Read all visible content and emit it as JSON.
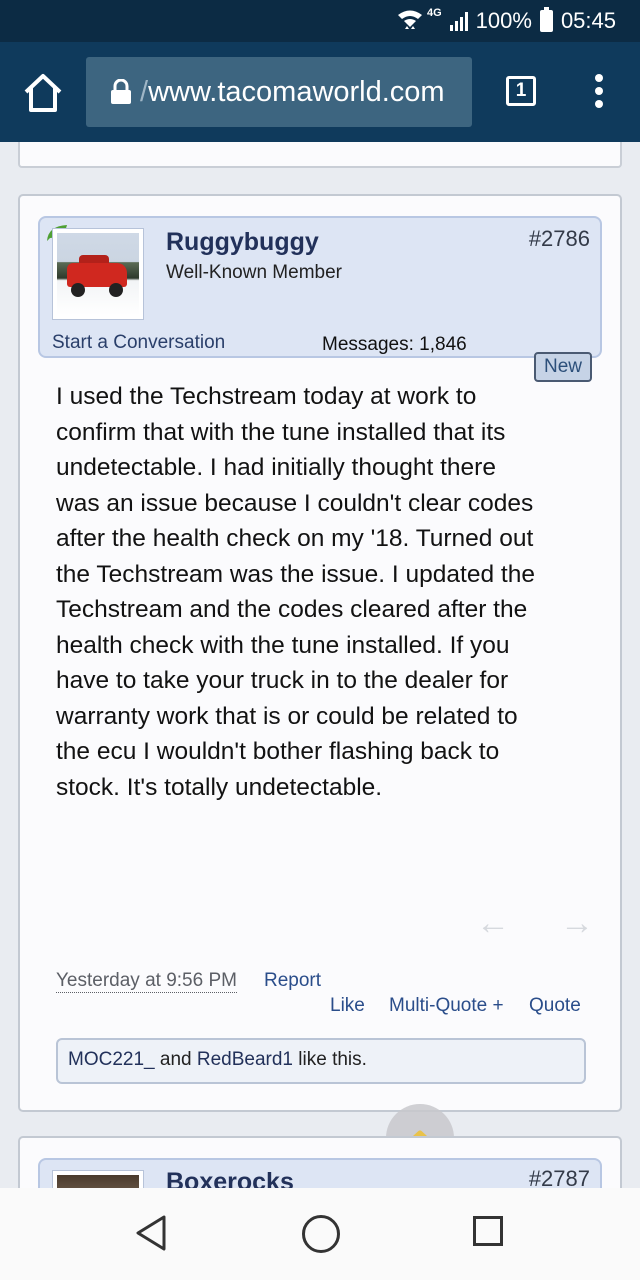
{
  "status_bar": {
    "network_type": "4G",
    "battery": "100%",
    "time": "05:45"
  },
  "browser": {
    "url_prefix": "/",
    "url": "www.tacomaworld.com",
    "tab_count": "1"
  },
  "post": {
    "username": "Ruggybuggy",
    "user_title": "Well-Known Member",
    "post_number": "#2786",
    "start_conversation": "Start a Conversation",
    "messages_label": "Messages:",
    "messages_count": "1,846",
    "new_badge": "New",
    "body": "I used the Techstream today at work to confirm that with the tune installed that its undetectable. I had initially thought there was an issue because I couldn't clear codes after the health check on my '18. Turned out the Techstream was the issue. I updated the Techstream and the codes cleared after the health check with the tune installed. If you have to take your truck in to the dealer for warranty work that is or could be related to the ecu I wouldn't bother flashing back to stock. It's totally undetectable.",
    "date": "Yesterday at 9:56 PM",
    "report": "Report",
    "like": "Like",
    "multi_quote": "Multi-Quote +",
    "quote": "Quote",
    "likes": {
      "user1": "MOC221_",
      "and": " and ",
      "user2": "RedBeard1",
      "suffix": " like this."
    }
  },
  "next_post": {
    "username": "Boxerocks",
    "post_number": "#2787"
  },
  "colors": {
    "status_bar": "#0c2b44",
    "toolbar": "#0f3a5c",
    "user_box": "#dde5f4",
    "link": "#2a4d8a"
  }
}
